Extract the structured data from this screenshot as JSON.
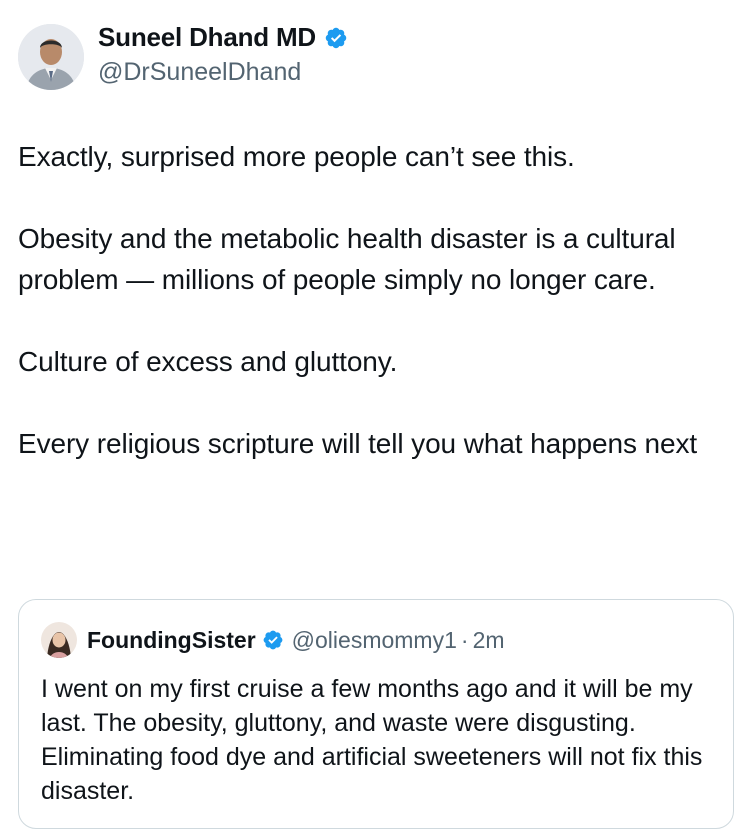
{
  "tweet": {
    "author": {
      "name": "Suneel Dhand MD",
      "handle": "@DrSuneelDhand",
      "verified_icon": "verified-badge-icon",
      "avatar_icon": "profile-photo-icon"
    },
    "paragraphs": [
      "Exactly, surprised more people can’t see this.",
      "Obesity and the metabolic health disaster is a cultural problem — millions of people simply no longer care.",
      "Culture of excess and gluttony.",
      "Every religious scripture will tell you what happens next"
    ]
  },
  "quote": {
    "author": {
      "name": "FoundingSister",
      "handle": "@oliesmommy1",
      "separator": "·",
      "time": "2m",
      "verified_icon": "verified-badge-icon",
      "avatar_icon": "profile-photo-icon"
    },
    "text": "I went on my first cruise a few months ago and it will be my last. The obesity, gluttony, and waste were disgusting. Eliminating food dye and artificial sweeteners will not fix this disaster."
  },
  "colors": {
    "verified": "#1d9bf0",
    "text": "#0f1419",
    "secondary_text": "#536471",
    "border": "#cfd9de"
  }
}
